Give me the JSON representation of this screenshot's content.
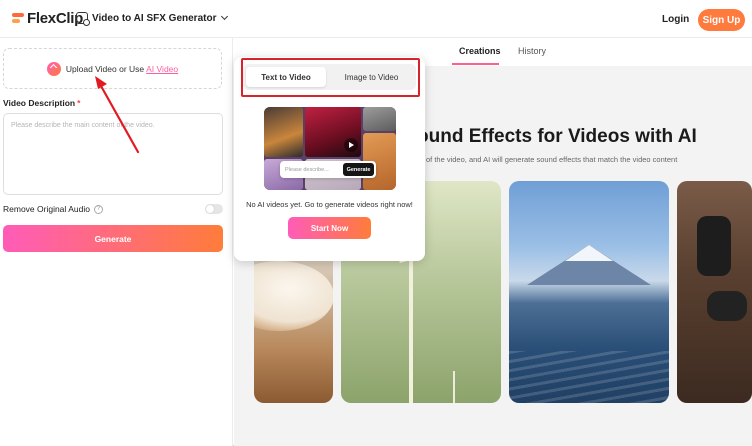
{
  "header": {
    "logo_text": "FlexClip",
    "tool_name": "Video to AI SFX Generator",
    "login": "Login",
    "signup": "Sign Up"
  },
  "left_panel": {
    "upload_text": "Upload Video or Use",
    "upload_link": "AI Video",
    "description_label": "Video Description",
    "required_mark": "*",
    "description_placeholder": "Please describe the main content of the video.",
    "remove_audio_label": "Remove Original Audio",
    "help_glyph": "?",
    "generate_button": "Generate"
  },
  "main": {
    "tabs": [
      {
        "label": "Creations",
        "active": true
      },
      {
        "label": "History",
        "active": false
      }
    ],
    "hero_title": "ound Effects for Videos with AI",
    "hero_subtitle": "of the video, and AI will generate sound effects that match the video content"
  },
  "popup": {
    "tabs": [
      {
        "label": "Text to Video",
        "active": true
      },
      {
        "label": "Image to Video",
        "active": false
      }
    ],
    "preview_input_placeholder": "Please describe...",
    "preview_generate": "Generate",
    "empty_message": "No AI videos yet. Go to generate videos right now!",
    "start_button": "Start Now"
  },
  "colors": {
    "accent_gradient_start": "#ff5cb8",
    "accent_gradient_end": "#ff7c3a",
    "signup_bg": "#ff7a3d",
    "annotation_red": "#d6242a"
  },
  "icons": {
    "logo": "flexclip-logo-icon",
    "tool": "video-sfx-icon",
    "dropdown": "chevron-down-icon",
    "upload": "upload-icon",
    "help": "help-icon",
    "play": "play-icon"
  }
}
